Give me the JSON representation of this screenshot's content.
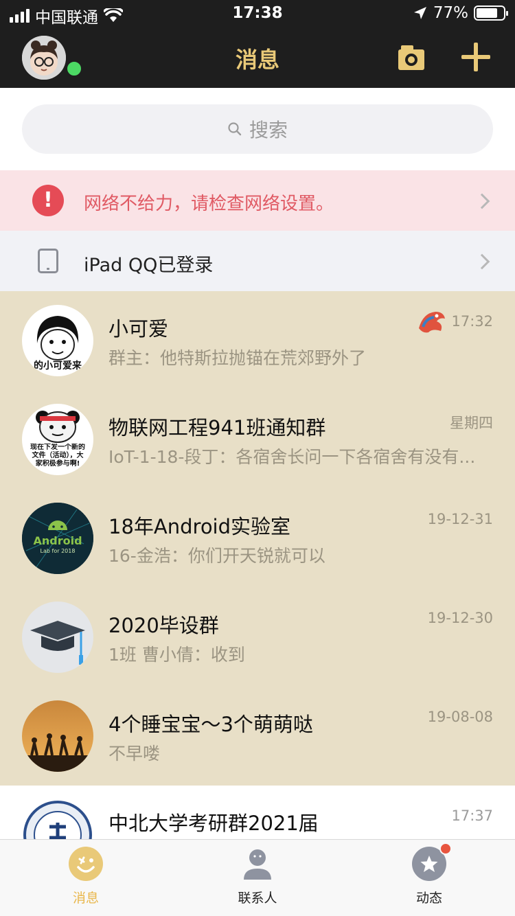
{
  "status_bar": {
    "carrier": "中国联通",
    "time": "17:38",
    "battery": "77%"
  },
  "header": {
    "title": "消息"
  },
  "search": {
    "placeholder": "搜索"
  },
  "network_warning": {
    "text": "网络不给力，请检查网络设置。"
  },
  "device_login": {
    "text": "iPad QQ已登录"
  },
  "chats": [
    {
      "name": "小可爱",
      "message": "群主：他特斯拉抛锚在荒郊野外了",
      "time": "17:32",
      "avatar_caption": "的小可爱来"
    },
    {
      "name": "物联网工程941班通知群",
      "message": "IoT-1-18-段丁：各宿舍长问一下各宿舍有没有...",
      "time": "星期四",
      "avatar_caption": "现在下发一个新的文件（活动），大家积极参与啊!"
    },
    {
      "name": "18年Android实验室",
      "message": "16-金浩：你们开天锐就可以",
      "time": "19-12-31",
      "avatar_caption": "Android",
      "avatar_sub": "Lab for 2018"
    },
    {
      "name": "2020毕设群",
      "message": "1班 曹小倩：收到",
      "time": "19-12-30"
    },
    {
      "name": "4个睡宝宝～3个萌萌哒",
      "message": "不早喽",
      "time": "19-08-08"
    },
    {
      "name": "中北大学考研群2021届",
      "message": "",
      "time": "17:37"
    }
  ],
  "tabs": [
    {
      "label": "消息",
      "active": true
    },
    {
      "label": "联系人",
      "active": false
    },
    {
      "label": "动态",
      "active": false,
      "has_dot": true
    }
  ],
  "colors": {
    "header_bg": "#1e1e1e",
    "accent": "#e9c978",
    "warning_bg": "#fae3e6",
    "warning_text": "#e05a64",
    "pinned_bg": "#e8dfc7",
    "online": "#4cd964"
  }
}
